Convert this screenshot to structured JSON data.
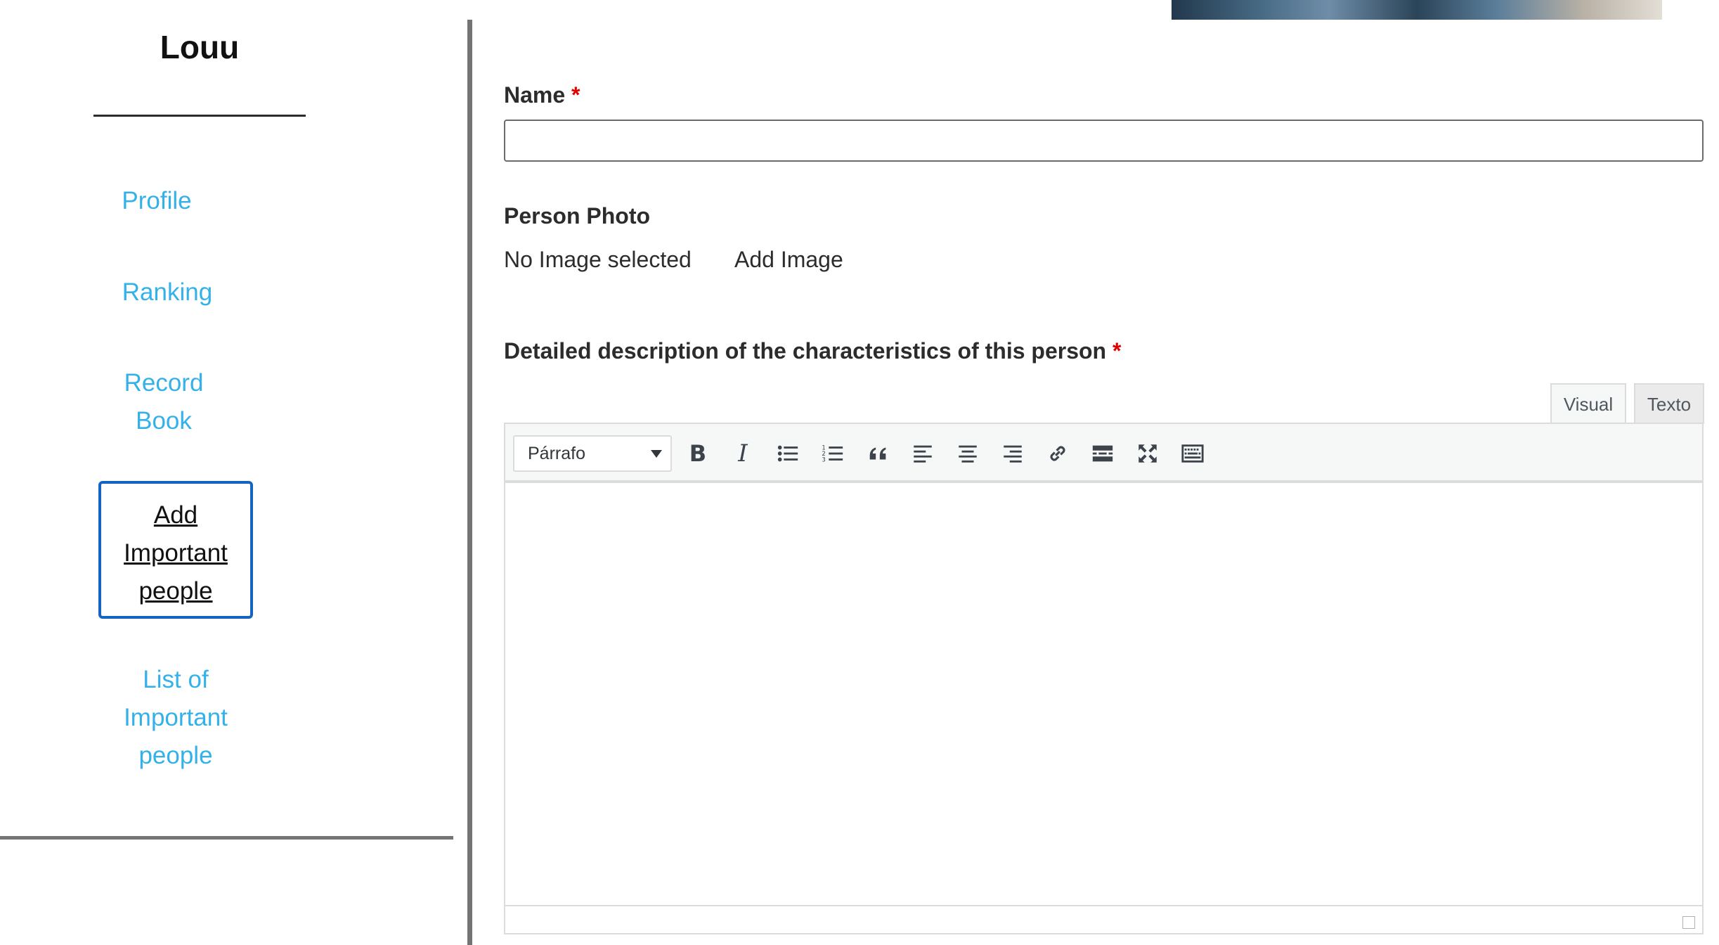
{
  "sidebar": {
    "user_name": "Louu",
    "nav": {
      "profile": "Profile",
      "ranking": "Ranking",
      "record_book_line1": "Record",
      "record_book_line2": "Book",
      "add_people_line1": "Add",
      "add_people_line2": "Important",
      "add_people_line3": "people",
      "list_people_line1": "List of",
      "list_people_line2": "Important",
      "list_people_line3": "people"
    }
  },
  "form": {
    "name_label": "Name",
    "name_required": "*",
    "name_value": "",
    "photo_label": "Person Photo",
    "photo_status": "No Image selected",
    "add_image_label": "Add Image",
    "description_label": "Detailed description of the characteristics of this person",
    "description_required": "*"
  },
  "editor": {
    "tab_visual": "Visual",
    "tab_text": "Texto",
    "format_value": "Párrafo",
    "toolbar_icons": [
      "bold-icon",
      "italic-icon",
      "bullet-list-icon",
      "numbered-list-icon",
      "blockquote-icon",
      "align-left-icon",
      "align-center-icon",
      "align-right-icon",
      "link-icon",
      "read-more-icon",
      "fullscreen-icon",
      "toolbar-toggle-icon"
    ]
  },
  "colors": {
    "link": "#35b1ea",
    "active_border": "#1565c0",
    "required": "#e00000",
    "divider": "#747474"
  }
}
